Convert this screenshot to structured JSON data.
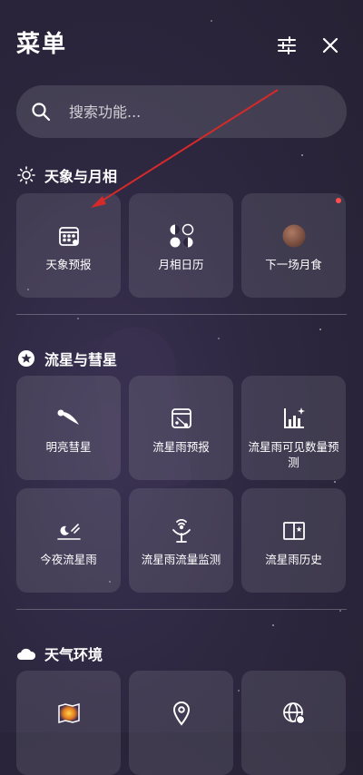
{
  "header": {
    "title": "菜单",
    "settings_icon": "sliders-icon",
    "close_icon": "close-icon"
  },
  "search": {
    "placeholder": "搜索功能...",
    "icon": "search-icon"
  },
  "sections": [
    {
      "title": "天象与月相",
      "icon": "sun-icon",
      "items": [
        {
          "label": "天象预报",
          "icon": "calendar-icon"
        },
        {
          "label": "月相日历",
          "icon": "moon-phases-icon"
        },
        {
          "label": "下一场月食",
          "icon": "moon-icon",
          "badge": true
        }
      ]
    },
    {
      "title": "流星与彗星",
      "icon": "star-icon",
      "items": [
        {
          "label": "明亮彗星",
          "icon": "comet-icon"
        },
        {
          "label": "流星雨预报",
          "icon": "meteor-calendar-icon"
        },
        {
          "label": "流星雨可见数量预测",
          "icon": "bar-chart-icon"
        },
        {
          "label": "今夜流星雨",
          "icon": "night-meteor-icon"
        },
        {
          "label": "流星雨流量监测",
          "icon": "antenna-icon"
        },
        {
          "label": "流星雨历史",
          "icon": "book-icon"
        }
      ]
    },
    {
      "title": "天气环境",
      "icon": "cloud-icon",
      "items": [
        {
          "label": "",
          "icon": "light-pollution-map-icon"
        },
        {
          "label": "",
          "icon": "location-pin-icon"
        },
        {
          "label": "",
          "icon": "globe-icon"
        }
      ]
    }
  ],
  "colors": {
    "background": "#2d2740",
    "tile": "#3f3a55",
    "badge": "#ff4d4d",
    "annotation_arrow": "#d42a2a"
  }
}
